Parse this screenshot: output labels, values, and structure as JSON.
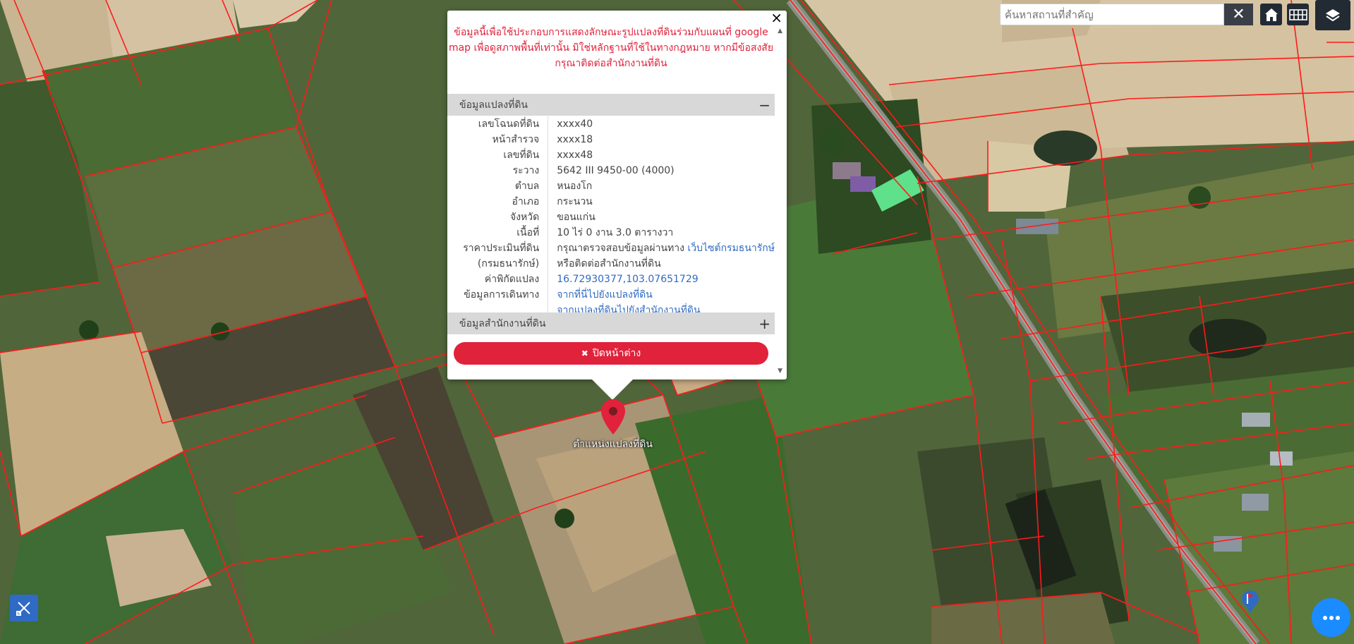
{
  "search": {
    "placeholder": "ค้นหาสถานที่สำคัญ",
    "clear_label": "✕"
  },
  "popup": {
    "close_label": "×",
    "disclaimer": "ข้อมูลนี้เพื่อใช้ประกอบการแสดงลักษณะรูปแปลงที่ดินร่วมกับแผนที่ google map เพื่อดูสภาพพื้นที่เท่านั้น มิใช่หลักฐานที่ใช้ในทางกฎหมาย หากมีข้อสงสัย กรุณาติดต่อสำนักงานที่ดิน",
    "section1_title": "ข้อมูลแปลงที่ดิน",
    "section1_toggle": "−",
    "section2_title": "ข้อมูลสำนักงานที่ดิน",
    "section2_toggle": "+",
    "rows": [
      {
        "label": "เลขโฉนดที่ดิน",
        "value": "xxxx40"
      },
      {
        "label": "หน้าสำรวจ",
        "value": "xxxx18"
      },
      {
        "label": "เลขที่ดิน",
        "value": "xxxx48"
      },
      {
        "label": "ระวาง",
        "value": "5642 III 9450-00 (4000)"
      },
      {
        "label": "ตำบล",
        "value": "หนองโก"
      },
      {
        "label": "อำเภอ",
        "value": "กระนวน"
      },
      {
        "label": "จังหวัด",
        "value": "ขอนแก่น"
      },
      {
        "label": "เนื้อที่",
        "value": "10 ไร่ 0 งาน 3.0 ตารางวา"
      }
    ],
    "price_label": "ราคาประเมินที่ดิน",
    "price_label2": "(กรมธนารักษ์)",
    "price_text": "กรุณาตรวจสอบข้อมูลผ่านทาง ",
    "price_link": "เว็บไซต์กรมธนารักษ์",
    "price_text2": "หรือติดต่อสำนักงานที่ดิน",
    "coord_label": "ค่าพิกัดแปลง",
    "coord_value": "16.72930377,103.07651729",
    "route_label": "ข้อมูลการเดินทาง",
    "route_link1": "จากที่นี่ไปยังแปลงที่ดิน",
    "route_link2": "จากแปลงที่ดินไปยังสำนักงานที่ดิน",
    "close_button": "ปิดหน้าต่าง",
    "close_icon": "✖"
  },
  "marker_label": "ตำแหน่งแปลงที่ดิน",
  "colors": {
    "accent_red": "#e0223b",
    "link_blue": "#2f6bc4",
    "toolbar_dark": "#222a33",
    "fab_blue": "#1a8cff",
    "parcel_line": "#ff1a1a"
  },
  "icons": [
    "home-icon",
    "grid-icon",
    "layers-icon",
    "close-icon",
    "map-pin-icon",
    "draw-tool-icon",
    "more-dots-icon",
    "flag-marker-icon"
  ]
}
